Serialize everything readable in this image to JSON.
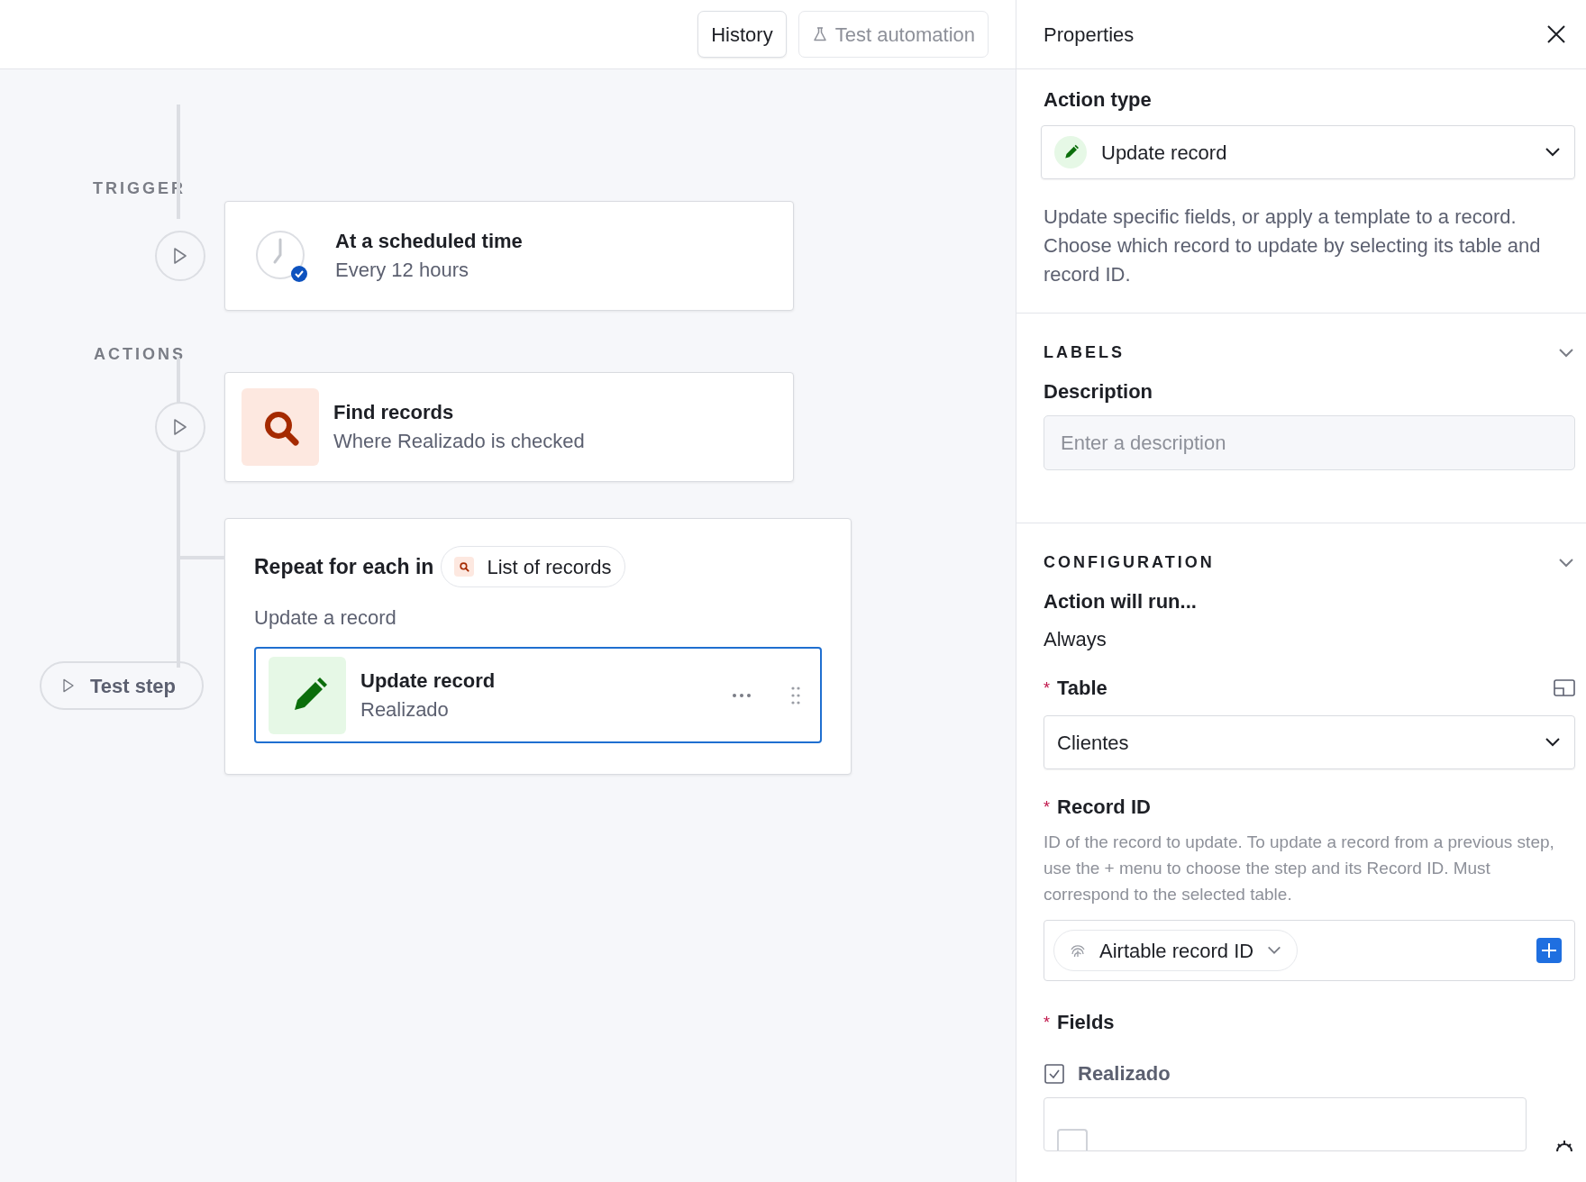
{
  "toolbar": {
    "buttons": [
      {
        "label": "History",
        "disabled": false
      },
      {
        "label": "Test automation",
        "disabled": true
      }
    ]
  },
  "flow": {
    "trigger": {
      "section_label": "TRIGGER",
      "title": "At a scheduled time",
      "subtitle": "Every 12 hours"
    },
    "actions_label": "ACTIONS",
    "actions": [
      {
        "kind": "find",
        "title": "Find records",
        "subtitle": "Where Realizado is checked"
      },
      {
        "kind": "loop",
        "heading": "Repeat for each in",
        "source": "List of records",
        "caption": "Update a record",
        "step": {
          "kind": "update",
          "title": "Update record",
          "subtitle": "Realizado",
          "selected": true
        }
      }
    ],
    "test_step_button": "Test step"
  },
  "properties": {
    "title": "Properties",
    "action_type": {
      "label": "Action type",
      "value": "Update record"
    },
    "description": "Update specific fields, or apply a template to a record. Choose which record to update by selecting its table and record ID.",
    "labels": {
      "heading": "LABELS",
      "expanded": true,
      "description_label": "Description",
      "placeholder": "Enter a description"
    },
    "configuration": {
      "heading": "CONFIGURATION",
      "expanded": true,
      "run_label": "Action will run...",
      "run_value": "Always",
      "table": {
        "required_mark": "*",
        "label": "Table",
        "value": "Clientes"
      },
      "record_id": {
        "required_mark": "*",
        "label": "Record ID",
        "help": "ID of the record to update. To update a record from a previous step, use the + menu to choose the step and its Record ID. Must correspond to the selected table.",
        "token": "Airtable record ID"
      },
      "fields": {
        "required_mark": "*",
        "label": "Fields",
        "items": [
          {
            "name": "Realizado",
            "checked": false
          }
        ]
      }
    }
  }
}
